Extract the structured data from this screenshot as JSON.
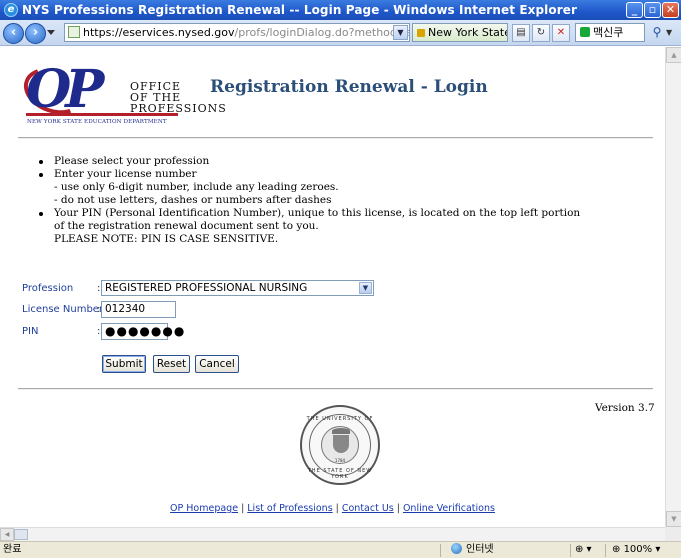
{
  "window": {
    "title": "NYS Professions Registration Renewal -- Login Page - Windows Internet Explorer",
    "minimize": "_",
    "maximize": "▫",
    "close": "✕"
  },
  "nav": {
    "back": "‹",
    "forward": "›",
    "url_scheme": "https://",
    "url_host": "eservices.nysed.gov",
    "url_path": "/profs/loginDialog.do?method=showLogin",
    "security_label": "New York State...",
    "search_text": "맥신쿠",
    "icons": [
      "page-icon",
      "refresh-icon",
      "stop-icon",
      "search-icon"
    ]
  },
  "logo": {
    "letters": "OP",
    "office_line1": "OFFICE",
    "office_line2": "OF THE",
    "office_line3": "PROFESSIONS",
    "department": "NEW YORK STATE EDUCATION DEPARTMENT"
  },
  "page_title": "Registration Renewal - Login",
  "instructions": [
    {
      "text": "Please select your profession",
      "bullet": true
    },
    {
      "text": "Enter your license number",
      "bullet": true
    },
    {
      "text": "- use only 6-digit number, include any leading zeroes.",
      "bullet": false
    },
    {
      "text": "- do not use letters, dashes or numbers after dashes",
      "bullet": false
    },
    {
      "text": "Your PIN (Personal Identification Number), unique to this license, is located on the top left portion",
      "bullet": true
    },
    {
      "text": "of the registration renewal document sent to you.",
      "bullet": false
    },
    {
      "text": "PLEASE NOTE: PIN IS CASE SENSITIVE.",
      "bullet": false
    }
  ],
  "form": {
    "profession_label": "Profession",
    "profession_value": "REGISTERED PROFESSIONAL NURSING",
    "license_label": "License Number",
    "license_value": "012340",
    "pin_label": "PIN",
    "pin_value": "●●●●●●●",
    "colon": ":",
    "submit": "Submit",
    "reset": "Reset",
    "cancel": "Cancel"
  },
  "version": "Version 3.7",
  "seal": {
    "top_text": "THE UNIVERSITY OF",
    "bottom_text": "THE STATE OF NEW YORK",
    "year": "1784"
  },
  "footer": {
    "links": [
      "OP Homepage",
      "List of Professions",
      "Contact Us",
      "Online Verifications"
    ],
    "separator": "|"
  },
  "status": {
    "done": "완료",
    "zone": "인터넷",
    "protected_mode": "⊕ ▾",
    "zoom": "100%",
    "zoom_caret": "▾"
  },
  "colors": {
    "title_bar": "#1f57c9",
    "page_title": "#2b4f78",
    "label": "#1f3f9a",
    "link": "#1a3bb0",
    "logo_blue": "#1f2b8c",
    "logo_red": "#b3202a"
  }
}
